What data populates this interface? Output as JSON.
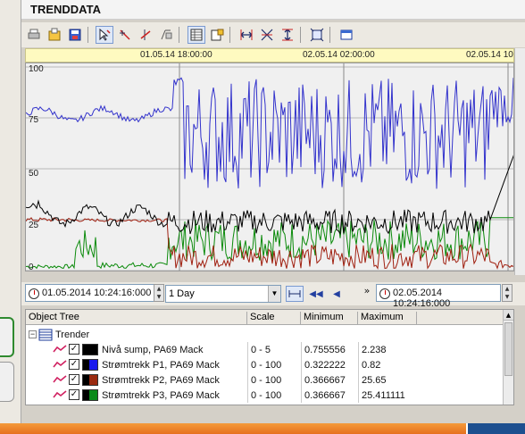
{
  "title": "TRENDDATA",
  "toolbar": {
    "icons": [
      "print-icon",
      "export-icon",
      "save-icon",
      "cursor-icon",
      "pen-icon",
      "vertical-line-icon",
      "copy-icon",
      "table-icon",
      "settings-icon",
      "zoom-horizontal-icon",
      "zoom-xy-icon",
      "zoom-vertical-icon",
      "fit-icon",
      "window-icon"
    ]
  },
  "time_axis": {
    "labels": [
      "01.05.14 18:00:00",
      "02.05.14 02:00:00",
      "02.05.14 10"
    ]
  },
  "chart_data": {
    "type": "line",
    "y_ticks": [
      "100",
      "75",
      "50",
      "25",
      "0"
    ],
    "ylim": [
      0,
      100
    ],
    "x_start": "01.05.2014 10:24:16",
    "x_end": "02.05.2014 10:24:16",
    "series": [
      {
        "name": "Nivå sump, PA69 Mack",
        "color": "#000000"
      },
      {
        "name": "Strømtrekk P1, PA69 Mack",
        "color": "#3333cc"
      },
      {
        "name": "Strømtrekk P2, PA69 Mack",
        "color": "#a02010"
      },
      {
        "name": "Strømtrekk P3, PA69 Mack",
        "color": "#0a8a0a"
      }
    ]
  },
  "controls": {
    "start_time": "01.05.2014 10:24:16:000",
    "period": "1 Day",
    "end_time": "02.05.2014 10:24:16:000",
    "forward_label": "»"
  },
  "object_tree": {
    "headers": [
      "Object Tree",
      "Scale",
      "Minimum",
      "Maximum"
    ],
    "group": "Trender",
    "rows": [
      {
        "name": "Nivå sump, PA69 Mack",
        "scale": "0 - 5",
        "min": "0.755556",
        "max": "2.238",
        "color": "#000000"
      },
      {
        "name": "Strømtrekk P1, PA69 Mack",
        "scale": "0 - 100",
        "min": "0.322222",
        "max": "0.82",
        "color": "#1a1aee"
      },
      {
        "name": "Strømtrekk P2, PA69 Mack",
        "scale": "0 - 100",
        "min": "0.366667",
        "max": "25.65",
        "color": "#9a2a10"
      },
      {
        "name": "Strømtrekk P3, PA69 Mack",
        "scale": "0 - 100",
        "min": "0.366667",
        "max": "25.411111",
        "color": "#0a8a1a"
      }
    ]
  }
}
